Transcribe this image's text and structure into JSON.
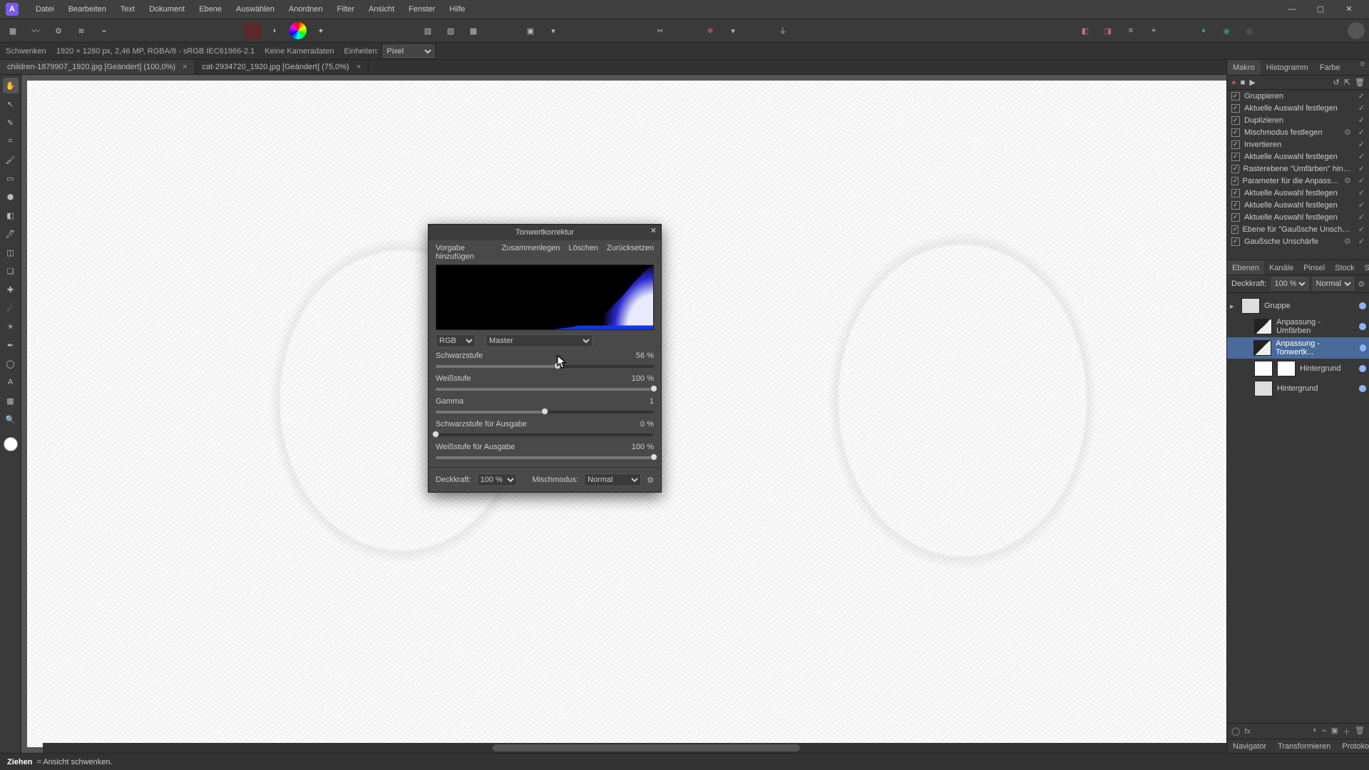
{
  "menu": {
    "items": [
      "Datei",
      "Bearbeiten",
      "Text",
      "Dokument",
      "Ebene",
      "Auswählen",
      "Anordnen",
      "Filter",
      "Ansicht",
      "Fenster",
      "Hilfe"
    ]
  },
  "infobar": {
    "tool": "Schwenken",
    "dims": "1920 × 1280 px, 2,46 MP, RGBA/8 - sRGB IEC61966-2.1",
    "camera": "Keine Kameradaten",
    "units_label": "Einheiten:",
    "units_value": "Pixel"
  },
  "tabs": [
    {
      "title": "children-1879907_1920.jpg [Geändert] (100,0%)",
      "active": true
    },
    {
      "title": "cat-2934720_1920.jpg [Geändert] (75,0%)",
      "active": false
    }
  ],
  "rp_top": {
    "tabs": [
      "Makro",
      "Histogramm",
      "Farbe"
    ],
    "active": 0
  },
  "makro": {
    "items": [
      {
        "label": "Gruppieren",
        "gear": false
      },
      {
        "label": "Aktuelle Auswahl festlegen",
        "gear": false
      },
      {
        "label": "Duplizieren",
        "gear": false
      },
      {
        "label": "Mischmodus festlegen",
        "gear": true
      },
      {
        "label": "Invertieren",
        "gear": false
      },
      {
        "label": "Aktuelle Auswahl festlegen",
        "gear": false
      },
      {
        "label": "Rasterebene \"Umfärben\" hinzufügen",
        "gear": false
      },
      {
        "label": "Parameter für die Anpassung festlegen",
        "gear": true
      },
      {
        "label": "Aktuelle Auswahl festlegen",
        "gear": false
      },
      {
        "label": "Aktuelle Auswahl festlegen",
        "gear": false
      },
      {
        "label": "Aktuelle Auswahl festlegen",
        "gear": false
      },
      {
        "label": "Ebene für \"Gaußsche Unschärfe\" hinzufügen",
        "gear": false
      },
      {
        "label": "Gaußsche Unschärfe",
        "gear": true
      }
    ]
  },
  "layers_header": {
    "tabs": [
      "Ebenen",
      "Kanäle",
      "Pinsel",
      "Stock",
      "Stile"
    ],
    "active": 0
  },
  "layers_opts": {
    "opacity_label": "Deckkraft:",
    "opacity": "100 %",
    "blend": "Normal"
  },
  "layers": [
    {
      "name": "Gruppe",
      "indent": 0,
      "sel": false,
      "thumb": "grp"
    },
    {
      "name": "Anpassung - Umfärben",
      "indent": 1,
      "sel": false,
      "thumb": "adj"
    },
    {
      "name": "Anpassung - Tonwertk...",
      "indent": 1,
      "sel": true,
      "thumb": "adj"
    },
    {
      "name": "Hintergrund",
      "indent": 1,
      "sel": false,
      "thumb": "mask",
      "extra": true
    },
    {
      "name": "Hintergrund",
      "indent": 1,
      "sel": false,
      "thumb": "img"
    }
  ],
  "bottom_tabs": [
    "Navigator",
    "Transformieren",
    "Protokoll"
  ],
  "status": {
    "action": "Ziehen",
    "desc": " = Ansicht schwenken."
  },
  "dialog": {
    "title": "Tonwertkorrektur",
    "add_preset": "Vorgabe hinzufügen",
    "merge": "Zusammenlegen",
    "delete": "Löschen",
    "reset": "Zurücksetzen",
    "colorspace": "RGB",
    "channel": "Master",
    "sliders": {
      "black": {
        "label": "Schwarzstufe",
        "value": "56 %",
        "pos": 56
      },
      "white": {
        "label": "Weißstufe",
        "value": "100 %",
        "pos": 100
      },
      "gamma": {
        "label": "Gamma",
        "value": "1",
        "pos": 50
      },
      "oblack": {
        "label": "Schwarzstufe für Ausgabe",
        "value": "0 %",
        "pos": 0
      },
      "owhite": {
        "label": "Weißstufe für Ausgabe",
        "value": "100 %",
        "pos": 100
      }
    },
    "opacity_label": "Deckkraft:",
    "opacity": "100 %",
    "blend_label": "Mischmodus:",
    "blend": "Normal"
  }
}
